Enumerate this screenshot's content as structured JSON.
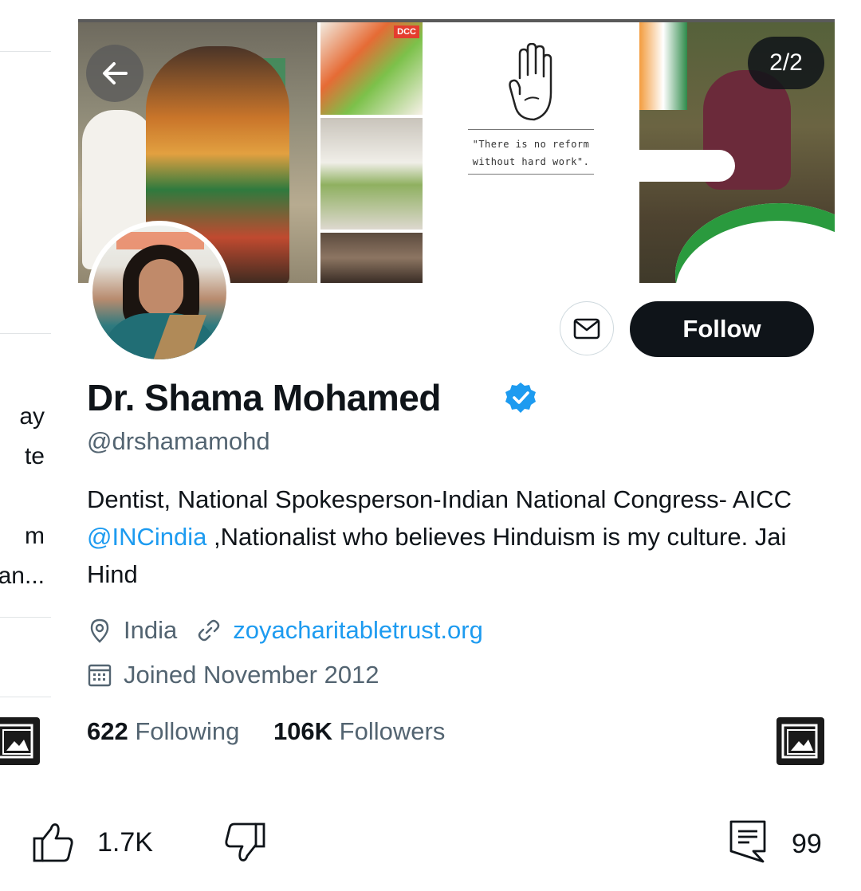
{
  "left_card": {
    "fragments": [
      "ay",
      "te",
      "m",
      "an..."
    ]
  },
  "banner": {
    "page_counter": "2/2",
    "badge_text": "DCC",
    "quote_text": "\"There is no reform without hard work\"."
  },
  "profile": {
    "name": "Dr. Shama Mohamed",
    "handle": "@drshamamohd",
    "bio_part1": "Dentist, National Spokesperson-Indian National Congress- AICC ",
    "bio_mention": "@INCindia",
    "bio_part2": " ,Nationalist who believes Hinduism is my culture. Jai Hind",
    "location": "India",
    "website": "zoyacharitabletrust.org",
    "joined": "Joined November 2012",
    "following_count": "622",
    "following_label": "Following",
    "followers_count": "106K",
    "followers_label": "Followers",
    "follow_button": "Follow"
  },
  "reactions": {
    "likes": "1.7K",
    "comments": "99"
  },
  "colors": {
    "accent": "#1d9bf0",
    "text_primary": "#0f1419",
    "text_secondary": "#536471",
    "follow_bg": "#0f1419"
  },
  "icons": [
    "back-arrow-icon",
    "mail-icon",
    "verified-badge-icon",
    "location-pin-icon",
    "link-icon",
    "calendar-icon",
    "gallery-icon",
    "thumbs-up-icon",
    "thumbs-down-icon",
    "comment-icon"
  ]
}
